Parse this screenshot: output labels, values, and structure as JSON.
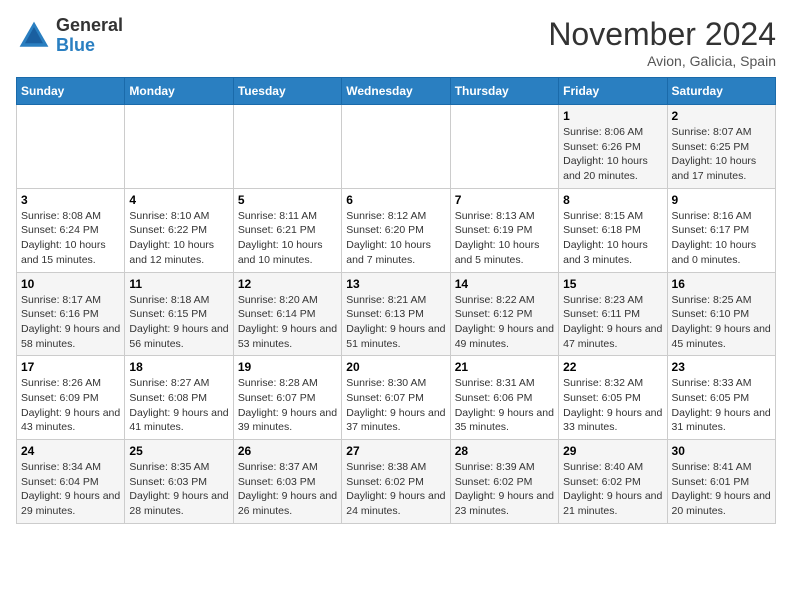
{
  "logo": {
    "general": "General",
    "blue": "Blue"
  },
  "header": {
    "month": "November 2024",
    "location": "Avion, Galicia, Spain"
  },
  "weekdays": [
    "Sunday",
    "Monday",
    "Tuesday",
    "Wednesday",
    "Thursday",
    "Friday",
    "Saturday"
  ],
  "days": [
    {
      "date": 1,
      "sunrise": "8:06 AM",
      "sunset": "6:26 PM",
      "daylight": "10 hours and 20 minutes."
    },
    {
      "date": 2,
      "sunrise": "8:07 AM",
      "sunset": "6:25 PM",
      "daylight": "10 hours and 17 minutes."
    },
    {
      "date": 3,
      "sunrise": "8:08 AM",
      "sunset": "6:24 PM",
      "daylight": "10 hours and 15 minutes."
    },
    {
      "date": 4,
      "sunrise": "8:10 AM",
      "sunset": "6:22 PM",
      "daylight": "10 hours and 12 minutes."
    },
    {
      "date": 5,
      "sunrise": "8:11 AM",
      "sunset": "6:21 PM",
      "daylight": "10 hours and 10 minutes."
    },
    {
      "date": 6,
      "sunrise": "8:12 AM",
      "sunset": "6:20 PM",
      "daylight": "10 hours and 7 minutes."
    },
    {
      "date": 7,
      "sunrise": "8:13 AM",
      "sunset": "6:19 PM",
      "daylight": "10 hours and 5 minutes."
    },
    {
      "date": 8,
      "sunrise": "8:15 AM",
      "sunset": "6:18 PM",
      "daylight": "10 hours and 3 minutes."
    },
    {
      "date": 9,
      "sunrise": "8:16 AM",
      "sunset": "6:17 PM",
      "daylight": "10 hours and 0 minutes."
    },
    {
      "date": 10,
      "sunrise": "8:17 AM",
      "sunset": "6:16 PM",
      "daylight": "9 hours and 58 minutes."
    },
    {
      "date": 11,
      "sunrise": "8:18 AM",
      "sunset": "6:15 PM",
      "daylight": "9 hours and 56 minutes."
    },
    {
      "date": 12,
      "sunrise": "8:20 AM",
      "sunset": "6:14 PM",
      "daylight": "9 hours and 53 minutes."
    },
    {
      "date": 13,
      "sunrise": "8:21 AM",
      "sunset": "6:13 PM",
      "daylight": "9 hours and 51 minutes."
    },
    {
      "date": 14,
      "sunrise": "8:22 AM",
      "sunset": "6:12 PM",
      "daylight": "9 hours and 49 minutes."
    },
    {
      "date": 15,
      "sunrise": "8:23 AM",
      "sunset": "6:11 PM",
      "daylight": "9 hours and 47 minutes."
    },
    {
      "date": 16,
      "sunrise": "8:25 AM",
      "sunset": "6:10 PM",
      "daylight": "9 hours and 45 minutes."
    },
    {
      "date": 17,
      "sunrise": "8:26 AM",
      "sunset": "6:09 PM",
      "daylight": "9 hours and 43 minutes."
    },
    {
      "date": 18,
      "sunrise": "8:27 AM",
      "sunset": "6:08 PM",
      "daylight": "9 hours and 41 minutes."
    },
    {
      "date": 19,
      "sunrise": "8:28 AM",
      "sunset": "6:07 PM",
      "daylight": "9 hours and 39 minutes."
    },
    {
      "date": 20,
      "sunrise": "8:30 AM",
      "sunset": "6:07 PM",
      "daylight": "9 hours and 37 minutes."
    },
    {
      "date": 21,
      "sunrise": "8:31 AM",
      "sunset": "6:06 PM",
      "daylight": "9 hours and 35 minutes."
    },
    {
      "date": 22,
      "sunrise": "8:32 AM",
      "sunset": "6:05 PM",
      "daylight": "9 hours and 33 minutes."
    },
    {
      "date": 23,
      "sunrise": "8:33 AM",
      "sunset": "6:05 PM",
      "daylight": "9 hours and 31 minutes."
    },
    {
      "date": 24,
      "sunrise": "8:34 AM",
      "sunset": "6:04 PM",
      "daylight": "9 hours and 29 minutes."
    },
    {
      "date": 25,
      "sunrise": "8:35 AM",
      "sunset": "6:03 PM",
      "daylight": "9 hours and 28 minutes."
    },
    {
      "date": 26,
      "sunrise": "8:37 AM",
      "sunset": "6:03 PM",
      "daylight": "9 hours and 26 minutes."
    },
    {
      "date": 27,
      "sunrise": "8:38 AM",
      "sunset": "6:02 PM",
      "daylight": "9 hours and 24 minutes."
    },
    {
      "date": 28,
      "sunrise": "8:39 AM",
      "sunset": "6:02 PM",
      "daylight": "9 hours and 23 minutes."
    },
    {
      "date": 29,
      "sunrise": "8:40 AM",
      "sunset": "6:02 PM",
      "daylight": "9 hours and 21 minutes."
    },
    {
      "date": 30,
      "sunrise": "8:41 AM",
      "sunset": "6:01 PM",
      "daylight": "9 hours and 20 minutes."
    }
  ]
}
